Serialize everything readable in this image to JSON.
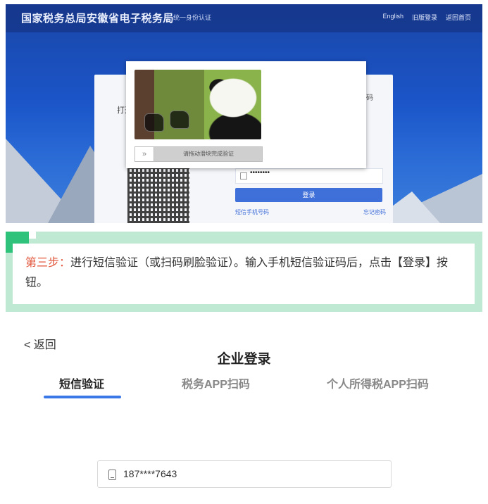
{
  "screenshot": {
    "site_title": "国家税务总局安徽省电子税务局",
    "site_subtitle": "统一身份认证",
    "top_links": [
      "English",
      "旧版登录",
      "返回首页"
    ],
    "qr_hint": "打开",
    "tab_label": "码",
    "password_mask": "••••••••",
    "login_button": "登录",
    "link_left": "短信手机号码",
    "link_right": "忘记密码",
    "captcha_slider_text": "请拖动滑块完成验证",
    "captcha_knob_icon": "double-chevron-right-icon"
  },
  "instruction": {
    "step_label": "第三步：",
    "text": "进行短信验证（或扫码刷脸验证）。输入手机短信验证码后，点击【登录】按钮。"
  },
  "mobile_login": {
    "back_label": "< 返回",
    "title": "企业登录",
    "tabs": [
      "短信验证",
      "税务APP扫码",
      "个人所得税APP扫码"
    ],
    "active_tab": "短信验证",
    "phone_icon": "mobile-phone-icon",
    "phone_value": "187****7643"
  },
  "colors": {
    "accent_blue": "#3a78e8",
    "step_red": "#e2563b",
    "note_border_green": "#bfe9d2",
    "note_tick_green": "#2fc27a"
  }
}
